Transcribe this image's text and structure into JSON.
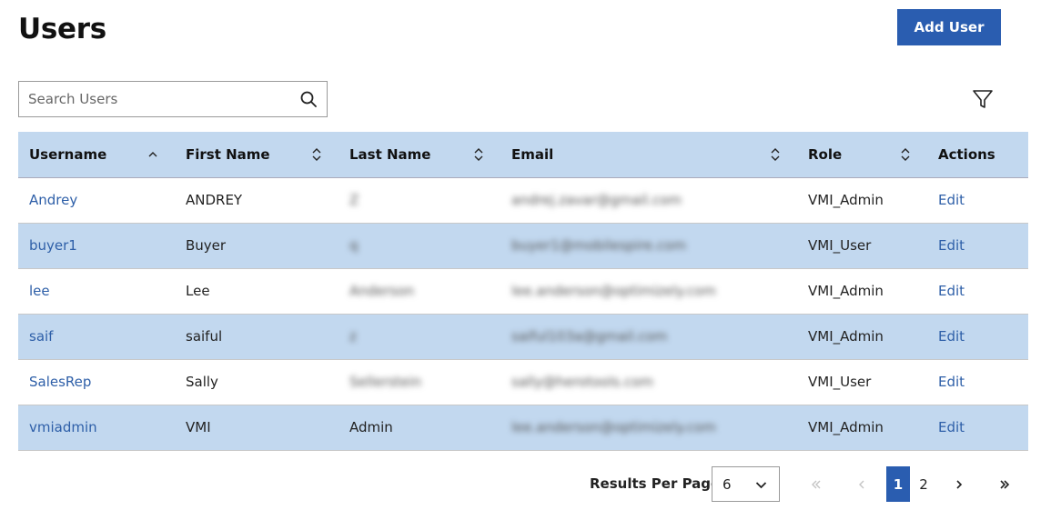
{
  "page": {
    "title": "Users",
    "add_user_label": "Add User"
  },
  "search": {
    "placeholder": "Search Users",
    "value": ""
  },
  "table": {
    "columns": [
      "Username",
      "First Name",
      "Last Name",
      "Email",
      "Role",
      "Actions"
    ],
    "rows": [
      {
        "username": "Andrey",
        "first_name": "ANDREY",
        "last_name": "Z",
        "email": "andrej.zavar@gmail.com",
        "role": "VMI_Admin",
        "action": "Edit"
      },
      {
        "username": "buyer1",
        "first_name": "Buyer",
        "last_name": "q",
        "email": "buyer1@mobilespire.com",
        "role": "VMI_User",
        "action": "Edit"
      },
      {
        "username": "lee",
        "first_name": "Lee",
        "last_name": "Anderson",
        "email": "lee.anderson@optimizely.com",
        "role": "VMI_Admin",
        "action": "Edit"
      },
      {
        "username": "saif",
        "first_name": "saiful",
        "last_name": "z",
        "email": "saiful103a@gmail.com",
        "role": "VMI_Admin",
        "action": "Edit"
      },
      {
        "username": "SalesRep",
        "first_name": "Sally",
        "last_name": "Sellerstein",
        "email": "sally@herotools.com",
        "role": "VMI_User",
        "action": "Edit"
      },
      {
        "username": "vmiadmin",
        "first_name": "VMI",
        "last_name": "Admin",
        "email": "lee.anderson@optimizely.com",
        "role": "VMI_Admin",
        "action": "Edit"
      }
    ]
  },
  "pagination": {
    "results_label": "Results Per Page",
    "per_page": "6",
    "pages": [
      "1",
      "2"
    ],
    "current_page": "1"
  },
  "colors": {
    "accent": "#2a5db0",
    "header_bg": "#c2d8ef",
    "link": "#2e5fa8"
  },
  "icons": {
    "search": "search-icon",
    "filter": "filter-icon",
    "sort": "sort-icon",
    "chevron": "chevron-down-icon"
  }
}
